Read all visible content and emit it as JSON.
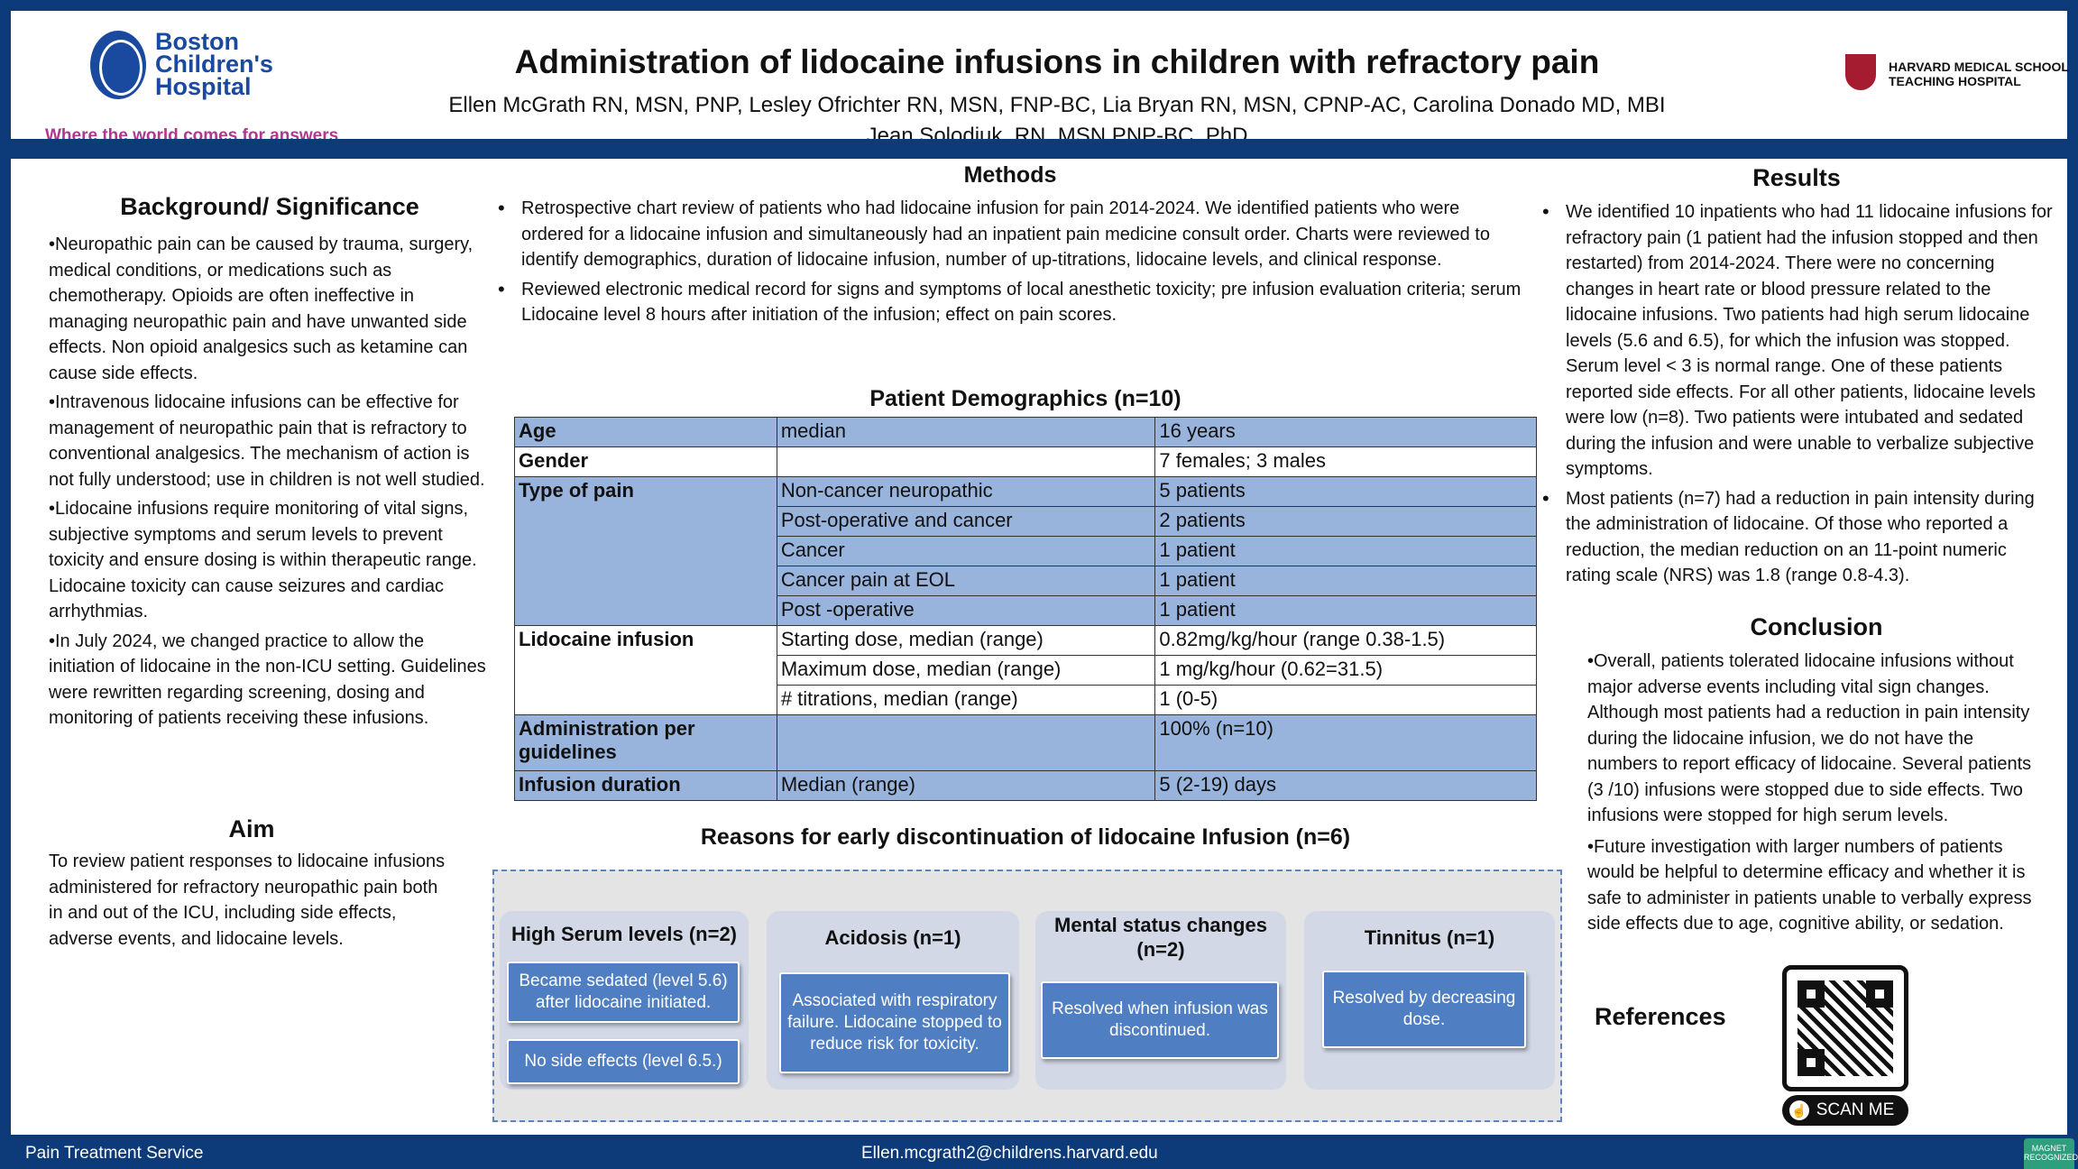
{
  "header": {
    "logo_name": [
      "Boston",
      "Children's",
      "Hospital"
    ],
    "logo_tagline": "Where the world comes for answers",
    "title": "Administration of lidocaine infusions in children with refractory pain",
    "authors_line1": "Ellen McGrath RN, MSN, PNP, Lesley Ofrichter RN, MSN, FNP-BC, Lia Bryan RN, MSN, CPNP-AC, Carolina Donado MD, MBI",
    "authors_line2": "Jean Solodiuk, RN, MSN PNP-BC, PhD",
    "affiliation_line1": "HARVARD MEDICAL SCHOOL",
    "affiliation_line2": "TEACHING HOSPITAL"
  },
  "background": {
    "title": "Background/ Significance",
    "paragraphs": [
      "•Neuropathic pain can be caused by trauma, surgery, medical conditions, or medications such as chemotherapy. Opioids are often ineffective in managing neuropathic pain and have unwanted side effects. Non opioid analgesics such as ketamine can cause side effects.",
      "•Intravenous lidocaine infusions can be effective for management of neuropathic pain that is refractory to conventional analgesics. The mechanism of action is not fully understood; use in children is not well studied.",
      "•Lidocaine infusions require monitoring of vital signs, subjective symptoms and serum levels to prevent toxicity and ensure dosing is within therapeutic range. Lidocaine toxicity can cause seizures and cardiac arrhythmias.",
      "•In July 2024, we changed practice to allow the initiation of lidocaine in the non-ICU setting. Guidelines were rewritten regarding screening, dosing and monitoring of patients receiving these infusions."
    ]
  },
  "aim": {
    "title": "Aim",
    "text": "To review patient responses to lidocaine infusions administered for refractory neuropathic pain both in and out of the ICU, including side effects, adverse events, and lidocaine levels."
  },
  "methods": {
    "title": "Methods",
    "bullets": [
      "Retrospective chart review of patients who had lidocaine infusion for pain 2014-2024. We identified patients who were ordered for a lidocaine infusion and simultaneously had an inpatient pain medicine consult order. Charts were reviewed to identify demographics, duration of lidocaine infusion, number of up-titrations, lidocaine levels, and clinical response.",
      "Reviewed electronic medical record for signs and symptoms of local anesthetic toxicity;  pre infusion evaluation criteria; serum Lidocaine level 8 hours after initiation of the infusion; effect on pain scores."
    ]
  },
  "demographics": {
    "title": "Patient Demographics (n=10)",
    "rows": [
      [
        "Age",
        "median",
        "16 years"
      ],
      [
        "Gender",
        "",
        "7 females; 3 males"
      ],
      [
        "Type of pain",
        "Non-cancer neuropathic",
        "5 patients"
      ],
      [
        "",
        "Post-operative and cancer",
        "2 patients"
      ],
      [
        "",
        "Cancer",
        "1 patient"
      ],
      [
        "",
        "Cancer pain at EOL",
        "1 patient"
      ],
      [
        "",
        "Post -operative",
        "1 patient"
      ],
      [
        "Lidocaine infusion",
        "Starting dose, median (range)",
        "0.82mg/kg/hour (range 0.38-1.5)"
      ],
      [
        "",
        "Maximum dose, median (range)",
        "1 mg/kg/hour (0.62=31.5)"
      ],
      [
        "",
        "#  titrations, median (range)",
        "1 (0-5)"
      ],
      [
        "Administration per guidelines",
        "",
        "100% (n=10)"
      ],
      [
        "Infusion duration",
        "Median (range)",
        " 5 (2-19) days"
      ]
    ]
  },
  "reasons": {
    "title": "Reasons for early discontinuation of lidocaine Infusion (n=6)",
    "cards": [
      {
        "head": "High Serum levels (n=2)",
        "boxes": [
          "Became sedated (level 5.6) after lidocaine initiated.",
          "No side effects (level 6.5.)"
        ]
      },
      {
        "head": "Acidosis (n=1)",
        "boxes": [
          "Associated with respiratory failure. Lidocaine stopped to reduce risk for toxicity."
        ]
      },
      {
        "head": "Mental status changes (n=2)",
        "boxes": [
          "Resolved when infusion was discontinued."
        ]
      },
      {
        "head": "Tinnitus (n=1)",
        "boxes": [
          "Resolved by decreasing dose."
        ]
      }
    ]
  },
  "results": {
    "title": "Results",
    "bullets": [
      "We identified 10 inpatients who had 11 lidocaine infusions for refractory pain (1 patient had the infusion stopped and then restarted) from 2014-2024. There were no concerning changes in heart rate or blood pressure related to the lidocaine infusions. Two patients had high serum lidocaine levels (5.6 and 6.5), for which the infusion was stopped. Serum level < 3 is normal range. One of these patients reported side effects. For all other patients, lidocaine levels were low (n=8). Two patients were intubated and sedated during the infusion and were unable to verbalize subjective symptoms.",
      "Most patients (n=7) had a reduction in pain intensity during the administration of lidocaine. Of those who reported a reduction, the median reduction on an 11-point numeric rating scale (NRS) was 1.8 (range 0.8-4.3)."
    ]
  },
  "conclusion": {
    "title": "Conclusion",
    "paragraphs": [
      "•Overall, patients tolerated lidocaine infusions without major adverse events including vital sign changes.  Although most patients had a reduction in pain intensity during the lidocaine infusion, we do not have the numbers to report efficacy of lidocaine.  Several patients (3 /10) infusions were stopped due to side effects. Two infusions were stopped for high serum levels.",
      "•Future investigation with larger numbers of patients would be helpful to determine efficacy and whether it is safe to administer in patients unable to verbally express side effects due to age, cognitive ability, or sedation."
    ]
  },
  "references": {
    "title": "References",
    "scan_label": "SCAN ME"
  },
  "footer": {
    "left": "Pain Treatment Service",
    "email": "Ellen.mcgrath2@childrens.harvard.edu",
    "badge": "MAGNET RECOGNIZED"
  }
}
